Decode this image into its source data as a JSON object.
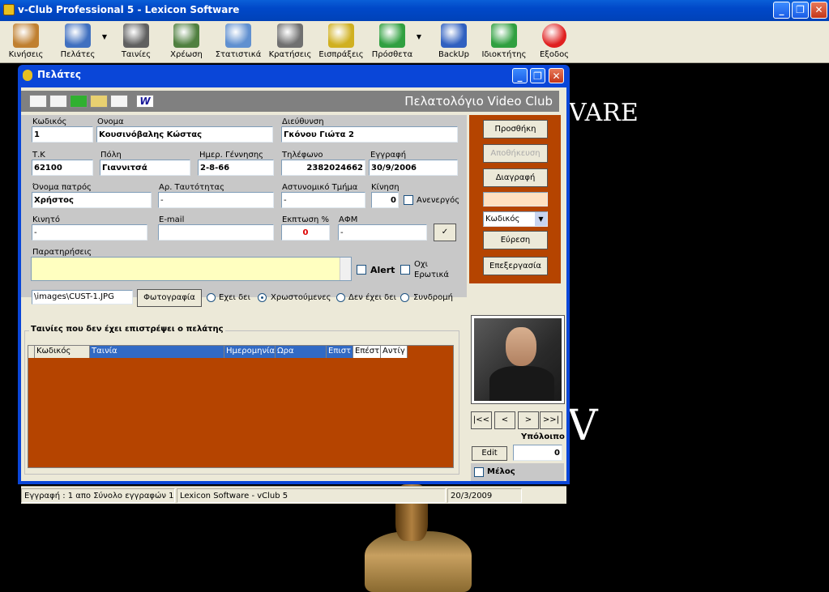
{
  "window": {
    "title": "v-Club Professional 5 - Lexicon Software",
    "min": "_",
    "max": "❐",
    "close": "✕"
  },
  "toolbar": {
    "items": [
      {
        "label": "Κινήσεις",
        "icon": "film-strip-icon",
        "color": "#c08030"
      },
      {
        "label": "Πελάτες",
        "icon": "users-search-icon",
        "color": "#4070c0"
      },
      {
        "label": "Ταινίες",
        "icon": "film-reel-icon",
        "color": "#606060"
      },
      {
        "label": "Χρέωση",
        "icon": "calculator-icon",
        "color": "#508040"
      },
      {
        "label": "Στατιστικά",
        "icon": "pie-chart-icon",
        "color": "#6090d0"
      },
      {
        "label": "Κρατήσεις",
        "icon": "reservation-icon",
        "color": "#707070"
      },
      {
        "label": "Εισπράξεις",
        "icon": "coins-icon",
        "color": "#d0b020"
      },
      {
        "label": "Πρόσθετα",
        "icon": "globe-icon",
        "color": "#30a040"
      },
      {
        "label": "BackUp",
        "icon": "backup-icon",
        "color": "#3060c0"
      },
      {
        "label": "Ιδιοκτήτης",
        "icon": "owner-icon",
        "color": "#30a040"
      },
      {
        "label": "Εξοδος",
        "icon": "exit-icon",
        "color": "#e02020"
      }
    ]
  },
  "desktop": {
    "bg_text1": "VARE",
    "bg_text2": "V"
  },
  "child": {
    "title": "Πελάτες",
    "header": "Πελατολόγιο Video Club"
  },
  "form": {
    "code_label": "Κωδικός",
    "code": "1",
    "name_label": "Ονομα",
    "name": "Κουσινόβαλης Κώστας",
    "address_label": "Διεύθυνση",
    "address": "Γκόνου Γιώτα 2",
    "tk_label": "Τ.Κ",
    "tk": "62100",
    "city_label": "Πόλη",
    "city": "Γιαννιτσά",
    "birth_label": "Ημερ. Γέννησης",
    "birth": "2-8-66",
    "phone_label": "Τηλέφωνο",
    "phone": "2382024662",
    "reg_label": "Εγγραφή",
    "reg": "30/9/2006",
    "father_label": "Όνομα πατρός",
    "father": "Χρήστος",
    "id_label": "Αρ. Ταυτότητας",
    "id": "-",
    "police_label": "Αστυνομικό Τμήμα",
    "police": "-",
    "move_label": "Κίνηση",
    "move": "0",
    "inactive_label": "Ανενεργός",
    "mobile_label": "Κινητό",
    "mobile": "-",
    "email_label": "E-mail",
    "email": "",
    "discount_label": "Εκπτωση %",
    "discount": "0",
    "afm_label": "ΑΦΜ",
    "afm": "-",
    "check": "✓",
    "remarks_label": "Παρατηρήσεις",
    "alert_label": "Alert",
    "no_erotica1": "Οχι",
    "no_erotica2": "Ερωτικά"
  },
  "photo": {
    "path": "\\images\\CUST-1.JPG",
    "button": "Φωτογραφία"
  },
  "radios": [
    "Εχει δει",
    "Χρωστούμενες",
    "Δεν έχει δει",
    "Συνδρομή"
  ],
  "right": {
    "add": "Προσθήκη",
    "save": "Αποθήκευση",
    "delete": "Διαγραφή",
    "search_value": "",
    "search_field": "Κωδικός",
    "find": "Εύρεση",
    "edit": "Επεξεργασία"
  },
  "grid": {
    "title": "Ταινίες που δεν έχει επιστρέψει ο πελάτης",
    "cols": [
      "Κωδικός",
      "Ταινία",
      "Ημερομηνία",
      "Ωρα",
      "Επιστ",
      "Επέστ",
      "Αντίγ"
    ]
  },
  "nav": {
    "first": "|<<",
    "prev": "<",
    "next": ">",
    "last": ">>|"
  },
  "balance": {
    "label": "Υπόλοιπο",
    "value": "0",
    "edit": "Edit",
    "member": "Μέλος"
  },
  "status": {
    "record": "Εγγραφή : 1 απο Σύνολο εγγραφών 1",
    "app": "Lexicon Software - vClub 5",
    "date": "20/3/2009"
  }
}
